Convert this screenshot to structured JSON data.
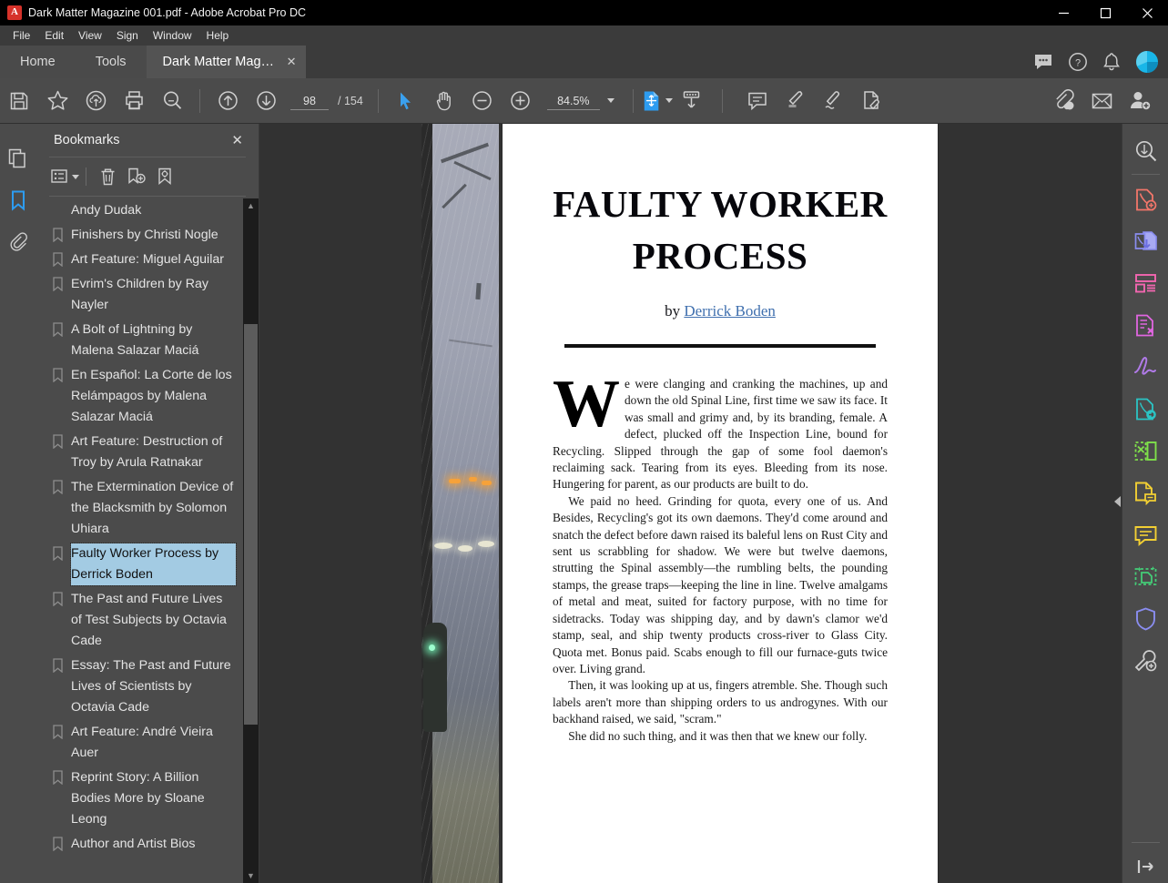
{
  "window": {
    "title": "Dark Matter Magazine 001.pdf - Adobe Acrobat Pro DC",
    "app_icon": "acrobat-icon",
    "minimize": "—",
    "maximize": "□",
    "close": "✕"
  },
  "menubar": {
    "items": [
      "File",
      "Edit",
      "View",
      "Sign",
      "Window",
      "Help"
    ]
  },
  "tabs": {
    "home": "Home",
    "tools": "Tools",
    "document": "Dark Matter Magaz...",
    "document_close": "✕",
    "right_icons": [
      "comment-bubble-icon",
      "help-icon",
      "bell-icon",
      "account-avatar-icon"
    ]
  },
  "toolbar": {
    "left_tools": [
      "save-icon",
      "add-to-favorites-icon",
      "upload-cloud-icon",
      "print-icon",
      "search-icon"
    ],
    "nav_tools": [
      "previous-page-icon",
      "next-page-icon"
    ],
    "page_current": "98",
    "page_total": "/ 154",
    "cursor_tools": [
      "select-tool-icon",
      "hand-tool-icon",
      "zoom-out-icon",
      "zoom-in-icon"
    ],
    "zoom_value": "84.5%",
    "fit_tool": "page-fit-icon",
    "scroll_tool": "scroll-mode-icon",
    "annot_tools": [
      "add-comment-icon",
      "highlight-icon",
      "sign-icon",
      "fill-and-sign-icon"
    ],
    "share_tools": [
      "share-link-icon",
      "email-icon",
      "invite-people-icon"
    ]
  },
  "left_rail": {
    "items": [
      {
        "name": "page-thumbnails-icon",
        "active": false
      },
      {
        "name": "bookmarks-icon",
        "active": true
      },
      {
        "name": "attachments-icon",
        "active": false
      }
    ]
  },
  "bookmarks_panel": {
    "title": "Bookmarks",
    "close_label": "✕",
    "toolbar": [
      "bookmark-options-icon",
      "delete-bookmark-icon",
      "new-bookmark-icon",
      "edit-bookmark-icon"
    ],
    "items": [
      {
        "label": "Andy Dudak",
        "selected": false,
        "no_icon": true
      },
      {
        "label": "Finishers by Christi Nogle",
        "selected": false
      },
      {
        "label": "Art Feature: Miguel Aguilar",
        "selected": false
      },
      {
        "label": "Evrim's Children by Ray Nayler",
        "selected": false
      },
      {
        "label": "A Bolt of Lightning by Malena Salazar Maciá",
        "selected": false
      },
      {
        "label": "En Español: La Corte de los Relámpagos by Malena Salazar Maciá",
        "selected": false
      },
      {
        "label": "Art Feature: Destruction of Troy by Arula Ratnakar",
        "selected": false
      },
      {
        "label": "The Extermination Device of the Blacksmith by Solomon Uhiara",
        "selected": false
      },
      {
        "label": "Faulty Worker Process by Derrick Boden",
        "selected": true
      },
      {
        "label": "The Past and Future Lives of Test Subjects by Octavia Cade",
        "selected": false
      },
      {
        "label": "Essay: The Past and Future Lives of Scientists by Octavia Cade",
        "selected": false
      },
      {
        "label": "Art Feature: André Vieira Auer",
        "selected": false
      },
      {
        "label": "Reprint Story: A Billion Bodies More by Sloane Leong",
        "selected": false
      },
      {
        "label": "Author and Artist Bios",
        "selected": false
      }
    ]
  },
  "document": {
    "title": "FAULTY WORKER PROCESS",
    "byline_prefix": "by ",
    "byline_author": "Derrick Boden",
    "dropcap": "W",
    "paragraphs": [
      "e were clanging and cranking the machines, up and down the old Spinal Line, first time we saw its face. It was small and grimy and, by its branding, female. A defect, plucked off the Inspection Line, bound for Recycling. Slipped through the gap of some fool daemon's reclaiming sack. Tearing from its eyes. Bleeding from its nose. Hungering for parent, as our products are built to do.",
      "We paid no heed. Grinding for quota, every one of us. And Besides, Recycling's got its own daemons. They'd come around and snatch the defect before dawn raised its baleful lens on Rust City and sent us scrabbling for shadow. We were but twelve daemons, strutting the Spinal assembly—the rumbling belts, the pounding stamps, the grease traps—keeping the line in line. Twelve amalgams of metal and meat, suited for factory purpose, with no time for sidetracks. Today was shipping day, and by dawn's clamor we'd stamp, seal, and ship twenty products cross-river to Glass City. Quota met. Bonus paid. Scabs enough to fill our furnace-guts twice over. Living grand.",
      "Then, it was looking up at us, fingers atremble. She. Though such labels aren't more than shipping orders to us androgynes. With our backhand raised, we said, \"scram.\"",
      "She did no such thing, and it was then that we knew our folly."
    ]
  },
  "right_rail": {
    "items": [
      {
        "name": "search-document-icon",
        "color": "#cfcfcf"
      },
      {
        "name": "create-pdf-icon",
        "color": "#f2766a"
      },
      {
        "name": "export-pdf-icon",
        "color": "#8a8df0"
      },
      {
        "name": "organize-pages-icon",
        "color": "#f266b0"
      },
      {
        "name": "redact-icon",
        "color": "#e066e0"
      },
      {
        "name": "fill-and-sign-icon",
        "color": "#b07ae8"
      },
      {
        "name": "send-for-signature-icon",
        "color": "#2bc4c4"
      },
      {
        "name": "compare-files-icon",
        "color": "#7fe04a"
      },
      {
        "name": "edit-pdf-icon",
        "color": "#f2cf33"
      },
      {
        "name": "comment-icon",
        "color": "#f2cf33"
      },
      {
        "name": "enhance-scans-icon",
        "color": "#44cc77"
      },
      {
        "name": "protect-icon",
        "color": "#8a8df0"
      },
      {
        "name": "more-tools-icon",
        "color": "#cfcfcf"
      },
      {
        "name": "collapse-panel-icon",
        "color": "#cfcfcf"
      }
    ]
  },
  "colors": {
    "accent_blue": "#2d9cf0",
    "selection_blue": "#a3cbe3",
    "titlebar_bg": "#000000",
    "chrome_bg": "#4b4b4b",
    "viewport_bg": "#323232"
  }
}
